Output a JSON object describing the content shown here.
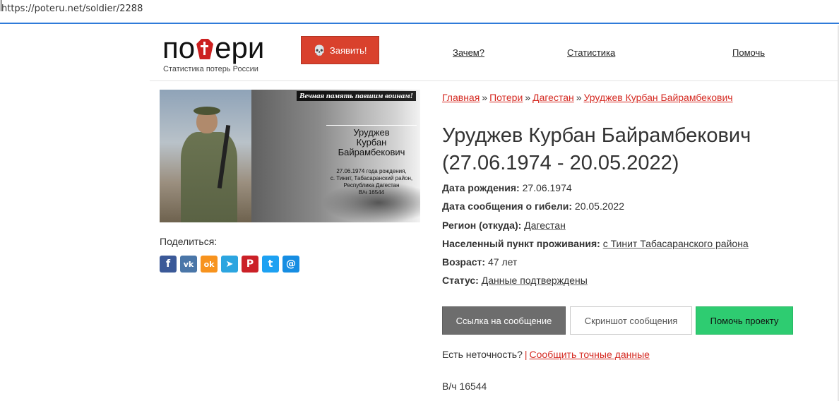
{
  "browser": {
    "url": "https://poteru.net/soldier/2288"
  },
  "header": {
    "logo_text_pre": "по",
    "logo_text_post": "ери",
    "tagline": "Статистика потерь России",
    "report_button": "Заявить!",
    "nav": [
      {
        "label": "Зачем?"
      },
      {
        "label": "Статистика"
      },
      {
        "label": "Помочь"
      }
    ]
  },
  "photo": {
    "caption_top": "Вечная память павшим воинам!",
    "name_lines": [
      "Уруджев",
      "Курбан",
      "Байрамбекович"
    ],
    "info_lines": [
      "27.06.1974 года рождения,",
      "с. Тинит, Табасаранский район,",
      "Республика Дагестан",
      "В/ч 16544"
    ]
  },
  "share": {
    "label": "Поделиться:",
    "icons": [
      {
        "name": "facebook",
        "glyph": "f",
        "color": "#3b5998"
      },
      {
        "name": "vk",
        "glyph": "vk",
        "color": "#4a76a8"
      },
      {
        "name": "odnoklassniki",
        "glyph": "ok",
        "color": "#f7931e"
      },
      {
        "name": "telegram",
        "glyph": "➤",
        "color": "#2ca5e0"
      },
      {
        "name": "pinterest",
        "glyph": "P",
        "color": "#cb2027"
      },
      {
        "name": "twitter",
        "glyph": "t",
        "color": "#1da1f2"
      },
      {
        "name": "email",
        "glyph": "@",
        "color": "#168de2"
      }
    ]
  },
  "breadcrumb": {
    "items": [
      "Главная",
      "Потери",
      "Дагестан",
      "Уруджев Курбан Байрамбекович"
    ],
    "separator": "»"
  },
  "profile": {
    "title": "Уруджев Курбан Байрамбекович (27.06.1974 - 20.05.2022)",
    "facts": [
      {
        "label": "Дата рождения:",
        "value": "27.06.1974",
        "link": false
      },
      {
        "label": "Дата сообщения о гибели:",
        "value": "20.05.2022",
        "link": false
      },
      {
        "label": "Регион (откуда):",
        "value": "Дагестан",
        "link": true
      },
      {
        "label": "Населенный пункт проживания:",
        "value": "с Тинит Табасаранского района",
        "link": true
      },
      {
        "label": "Возраст:",
        "value": "47 лет",
        "link": false
      },
      {
        "label": "Статус:",
        "value": "Данные подтверждены",
        "link": true
      }
    ]
  },
  "actions": {
    "link_button": "Ссылка на сообщение",
    "screenshot_button": "Скриншот сообщения",
    "help_button": "Помочь проекту"
  },
  "inaccuracy": {
    "question": "Есть неточность?",
    "separator": "|",
    "link": "Сообщить точные данные"
  },
  "unit": "В/ч 16544"
}
